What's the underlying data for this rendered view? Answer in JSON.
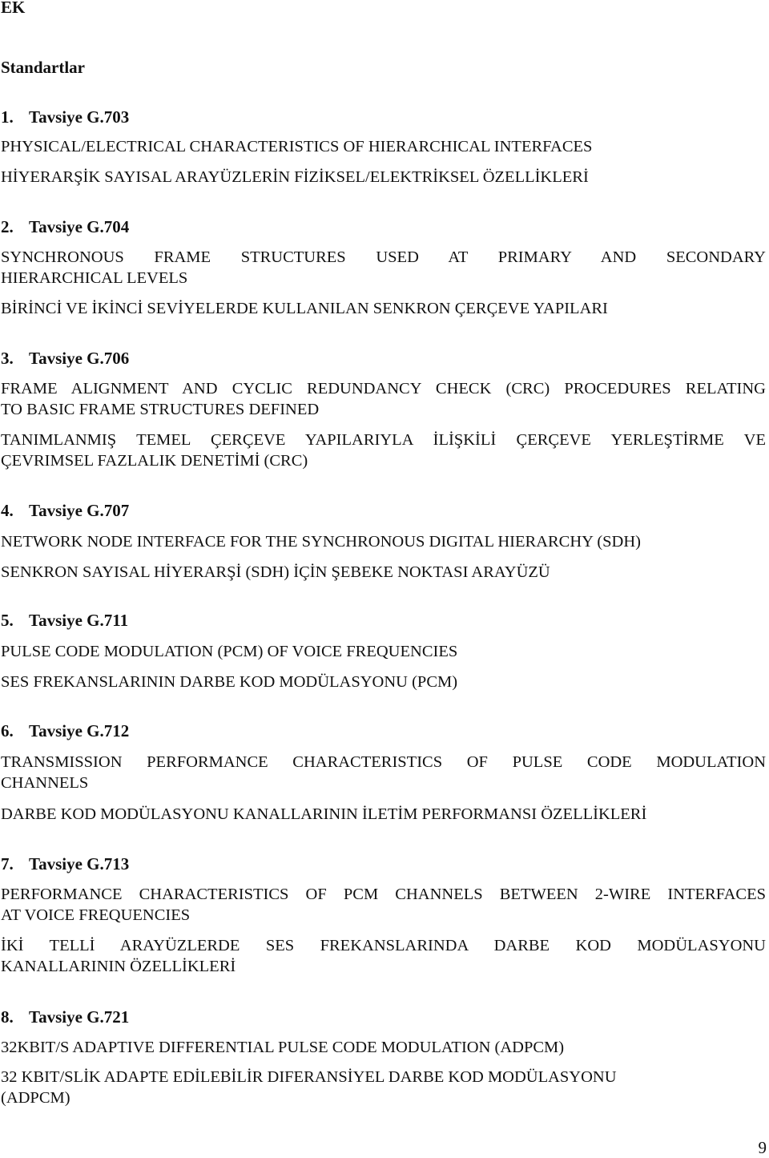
{
  "document": {
    "appendix_title": "EK",
    "section_title": "Standartlar",
    "page_number": "9",
    "items": [
      {
        "number": "1.",
        "heading": "Tavsiye G.703",
        "english": [
          "PHYSICAL/ELECTRICAL CHARACTERISTICS OF HIERARCHICAL INTERFACES"
        ],
        "turkish": [
          "HİYERARŞİK SAYISAL ARAYÜZLERİN FİZİKSEL/ELEKTRİKSEL ÖZELLİKLERİ"
        ]
      },
      {
        "number": "2.",
        "heading": "Tavsiye G.704",
        "english": [
          "SYNCHRONOUS FRAME STRUCTURES USED AT PRIMARY AND SECONDARY",
          "HIERARCHICAL LEVELS"
        ],
        "turkish": [
          "BİRİNCİ VE İKİNCİ SEVİYELERDE KULLANILAN SENKRON ÇERÇEVE YAPILARI"
        ]
      },
      {
        "number": "3.",
        "heading": "Tavsiye G.706",
        "english": [
          "FRAME ALIGNMENT AND CYCLIC REDUNDANCY CHECK (CRC) PROCEDURES RELATING",
          "TO BASIC FRAME STRUCTURES DEFINED"
        ],
        "turkish": [
          "TANIMLANMIŞ TEMEL ÇERÇEVE YAPILARIYLA İLİŞKİLİ ÇERÇEVE YERLEŞTİRME VE",
          "ÇEVRIMSEL FAZLALIK DENETİMİ (CRC)"
        ]
      },
      {
        "number": "4.",
        "heading": "Tavsiye G.707",
        "english": [
          "NETWORK NODE INTERFACE FOR THE SYNCHRONOUS DIGITAL HIERARCHY (SDH)"
        ],
        "turkish": [
          "SENKRON SAYISAL HİYERARŞİ  (SDH) İÇİN ŞEBEKE NOKTASI ARAYÜZÜ"
        ]
      },
      {
        "number": "5.",
        "heading": "Tavsiye G.711",
        "english": [
          "PULSE CODE MODULATION (PCM) OF VOICE FREQUENCIES"
        ],
        "turkish": [
          "SES FREKANSLARININ DARBE KOD MODÜLASYONU (PCM)"
        ]
      },
      {
        "number": "6.",
        "heading": "Tavsiye G.712",
        "english": [
          "TRANSMISSION PERFORMANCE CHARACTERISTICS OF PULSE CODE MODULATION",
          "CHANNELS"
        ],
        "turkish": [
          "DARBE KOD MODÜLASYONU KANALLARININ İLETİM PERFORMANSI ÖZELLİKLERİ"
        ]
      },
      {
        "number": "7.",
        "heading": "Tavsiye G.713",
        "english": [
          "PERFORMANCE CHARACTERISTICS OF PCM CHANNELS BETWEEN 2-WIRE INTERFACES",
          "AT VOICE FREQUENCIES"
        ],
        "turkish": [
          "İKİ TELLİ ARAYÜZLERDE SES FREKANSLARINDA DARBE KOD MODÜLASYONU",
          "KANALLARININ ÖZELLİKLERİ"
        ]
      },
      {
        "number": "8.",
        "heading": "Tavsiye G.721",
        "english": [
          "32KBIT/S ADAPTIVE DIFFERENTIAL PULSE CODE MODULATION (ADPCM)"
        ],
        "turkish": [
          "32 KBIT/SLİK ADAPTE EDİLEBİLİR DIFERANSİYEL DARBE KOD MODÜLASYONU",
          "(ADPCM)"
        ]
      }
    ]
  }
}
